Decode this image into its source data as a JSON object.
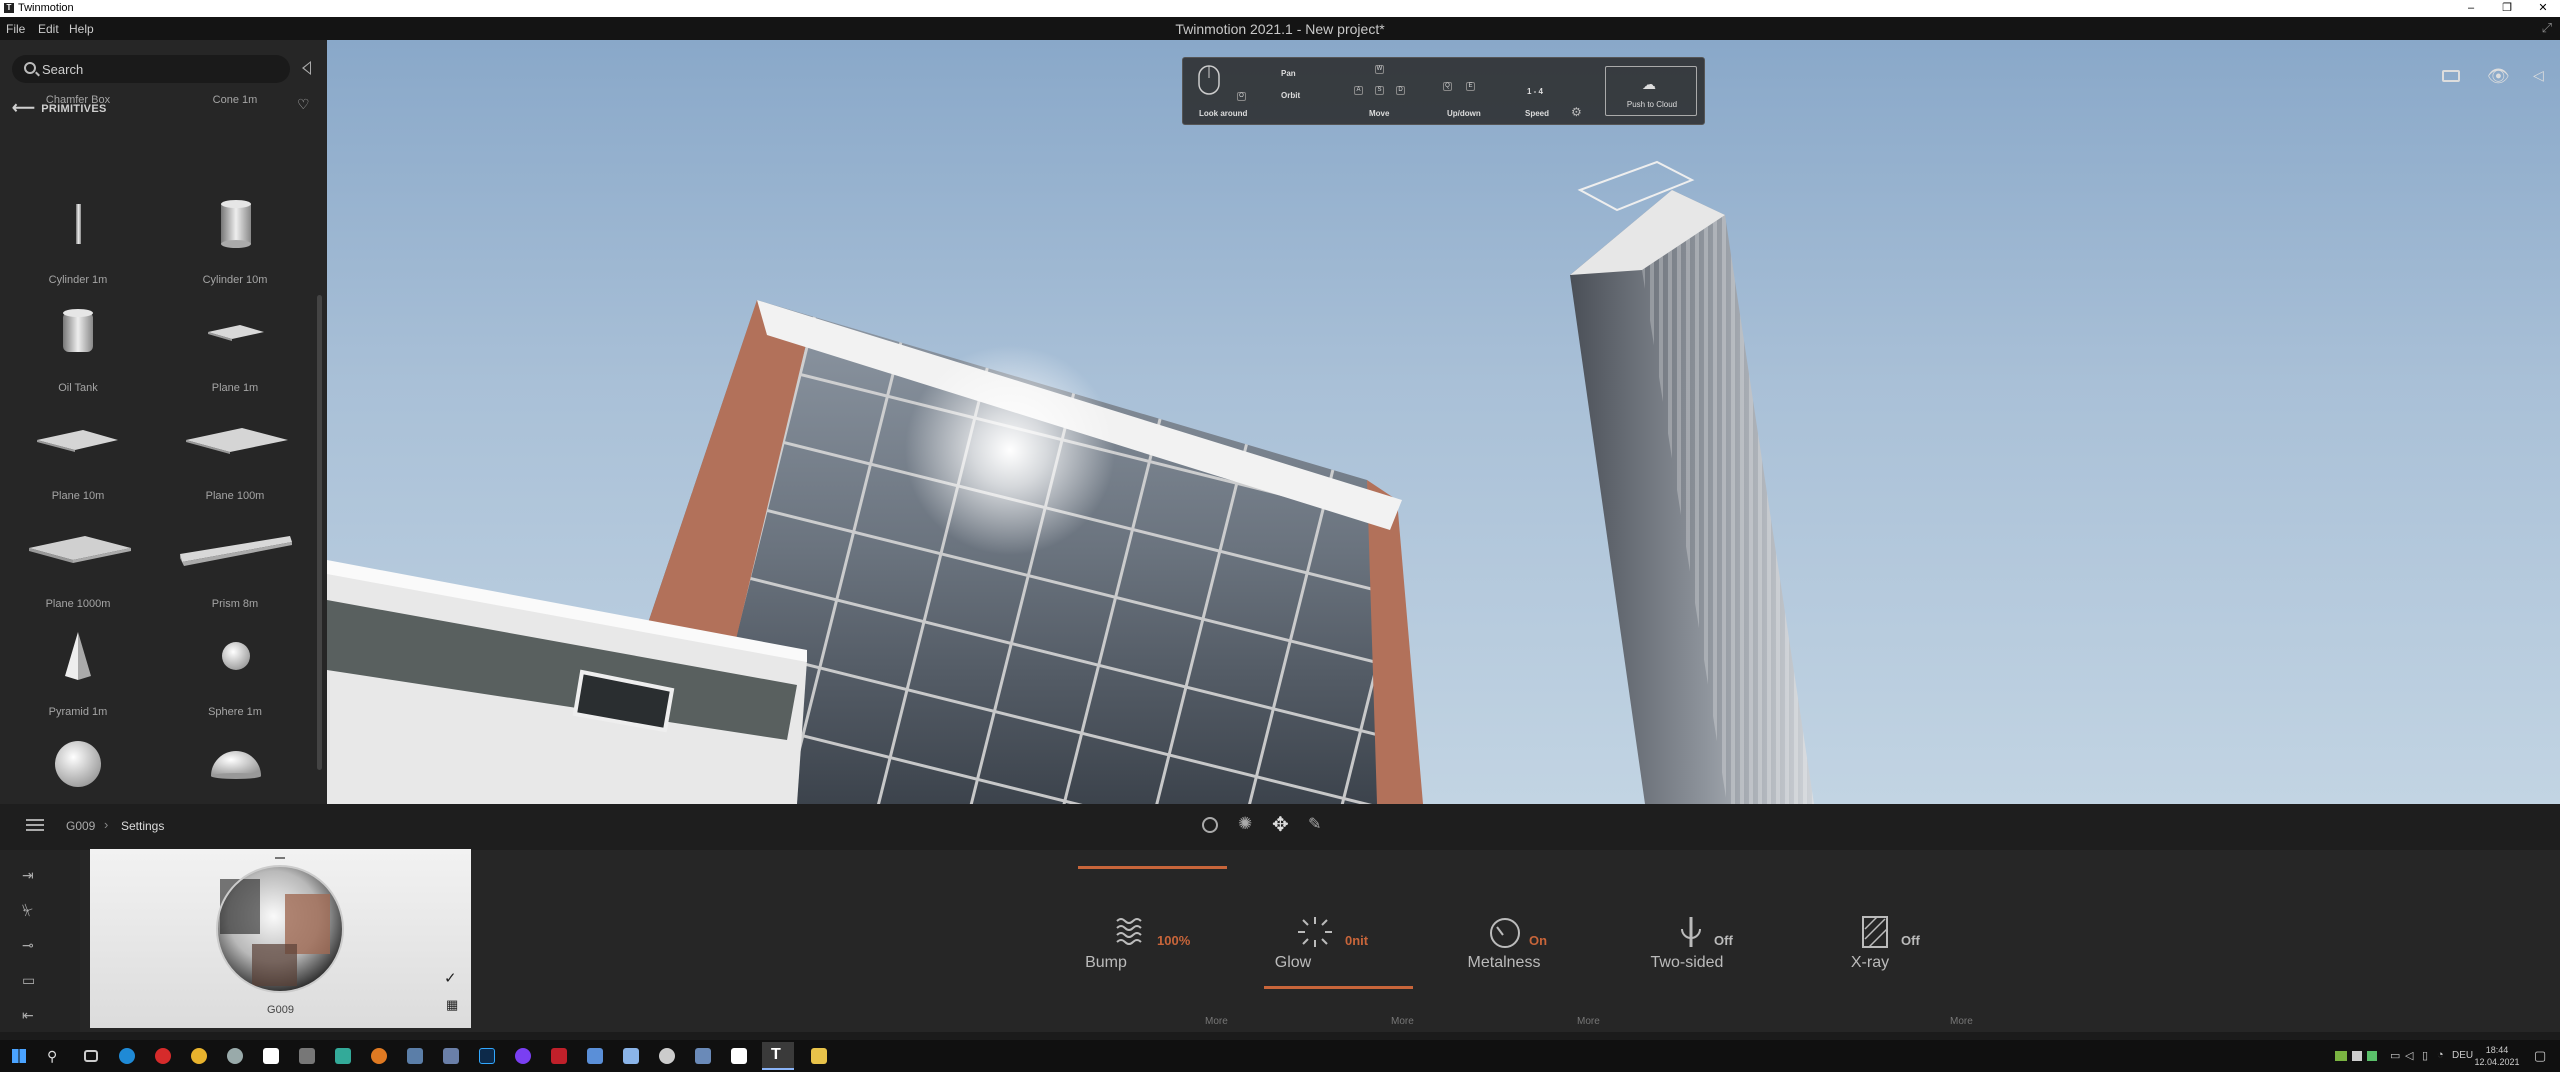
{
  "window": {
    "app_name": "Twinmotion",
    "title": "Twinmotion 2021.1 - New project*",
    "controls": [
      "–",
      "❐",
      "✕"
    ]
  },
  "menu": [
    "File",
    "Edit",
    "Help"
  ],
  "library": {
    "search_placeholder": "Search",
    "category": "PRIMITIVES",
    "items": [
      {
        "label": "Chamfer Box",
        "shape": "box"
      },
      {
        "label": "Cone 1m",
        "shape": "cone"
      },
      {
        "label": "Cylinder 1m",
        "shape": "thin-cylinder"
      },
      {
        "label": "Cylinder 10m",
        "shape": "cylinder"
      },
      {
        "label": "Oil Tank",
        "shape": "tank"
      },
      {
        "label": "Plane 1m",
        "shape": "plane-small"
      },
      {
        "label": "Plane 10m",
        "shape": "plane"
      },
      {
        "label": "Plane 100m",
        "shape": "plane"
      },
      {
        "label": "Plane 1000m",
        "shape": "plane-large"
      },
      {
        "label": "Prism 8m",
        "shape": "prism"
      },
      {
        "label": "Pyramid 1m",
        "shape": "pyramid"
      },
      {
        "label": "Sphere 1m",
        "shape": "sphere-small"
      },
      {
        "label": "",
        "shape": "sphere"
      },
      {
        "label": "",
        "shape": "hemisphere"
      }
    ]
  },
  "navigation_help": {
    "pan": "Pan",
    "orbit": "Orbit",
    "look_around": "Look around",
    "move": "Move",
    "updown": "Up/down",
    "speed": "Speed",
    "speed_keys": "1 - 4",
    "push_to_cloud": "Push to Cloud",
    "key_w": "W",
    "key_a": "A",
    "key_s": "S",
    "key_d": "D",
    "key_q": "Q",
    "key_e": "E",
    "key_o": "O"
  },
  "breadcrumb": {
    "item": "G009",
    "current": "Settings"
  },
  "material": {
    "name": "G009"
  },
  "properties": [
    {
      "label": "Bump",
      "value": "100%",
      "color": "#c8653a",
      "icon": "bump-icon"
    },
    {
      "label": "Glow",
      "value": "0nit",
      "color": "#c8653a",
      "icon": "glow-icon"
    },
    {
      "label": "Metalness",
      "value": "On",
      "color": "#c8653a",
      "icon": "metalness-icon"
    },
    {
      "label": "Two-sided",
      "value": "Off",
      "color": "#bbbbbb",
      "icon": "two-sided-icon"
    },
    {
      "label": "X-ray",
      "value": "Off",
      "color": "#bbbbbb",
      "icon": "xray-icon"
    }
  ],
  "more_labels": [
    "More",
    "More",
    "More",
    "More"
  ],
  "accent": "#c8653a",
  "taskbar": {
    "lang": "DEU",
    "time": "18:44",
    "date": "12.04.2021"
  }
}
